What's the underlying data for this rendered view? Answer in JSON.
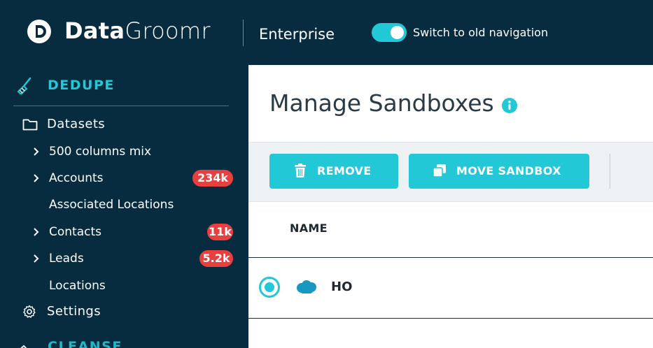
{
  "header": {
    "brand_bold": "Data",
    "brand_light": "Groomr",
    "edition": "Enterprise",
    "toggle_label": "Switch to old navigation",
    "toggle_on": true
  },
  "sidebar": {
    "section_title": "DEDUPE",
    "datasets_label": "Datasets",
    "items": [
      {
        "label": "500 columns mix",
        "expandable": true,
        "badge": ""
      },
      {
        "label": "Accounts",
        "expandable": true,
        "badge": "234k"
      },
      {
        "label": "Associated Locations",
        "expandable": false,
        "badge": ""
      },
      {
        "label": "Contacts",
        "expandable": true,
        "badge": "11k"
      },
      {
        "label": "Leads",
        "expandable": true,
        "badge": "5.2k"
      },
      {
        "label": "Locations",
        "expandable": false,
        "badge": ""
      }
    ],
    "settings_label": "Settings",
    "next_section_title": "CLEANSE"
  },
  "main": {
    "title": "Manage Sandboxes",
    "toolbar": {
      "remove_label": "REMOVE",
      "move_label": "MOVE SANDBOX"
    },
    "table": {
      "columns": [
        "NAME"
      ],
      "rows": [
        {
          "name": "HO",
          "selected": true,
          "icon": "salesforce-cloud-icon"
        }
      ]
    }
  },
  "colors": {
    "navy": "#072c3f",
    "accent": "#22c8d6",
    "badge_red": "#e8403f",
    "text_dark": "#1d2a31"
  }
}
